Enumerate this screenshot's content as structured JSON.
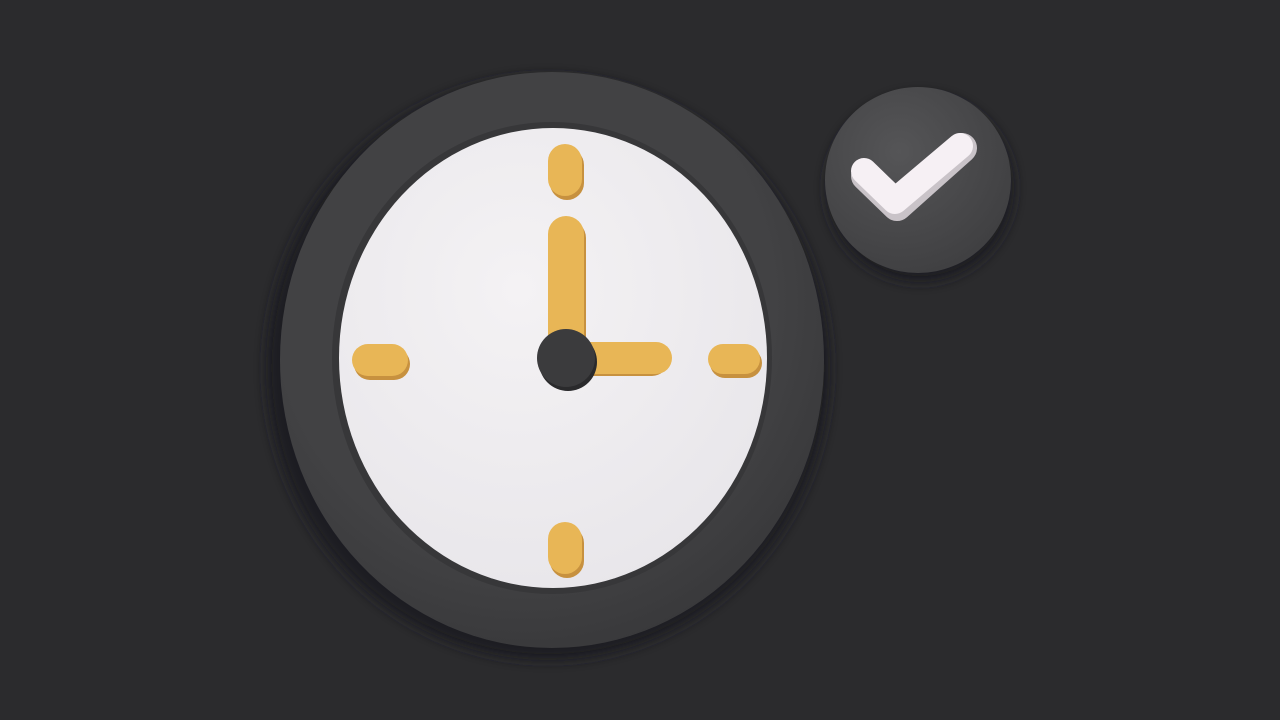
{
  "scene": {
    "background_color": "#2b2b2d",
    "clock": {
      "rim_color": "#424244",
      "rim_shadow_color": "#373739",
      "face_color": "#e8e6ea",
      "face_highlight_color": "#f4f2f4",
      "marker_color": "#e8b656",
      "marker_shadow_color": "#c7913f",
      "hub_color": "#3b3b3d",
      "shown_time": {
        "hour": 3,
        "minute": 0
      }
    },
    "check_badge": {
      "badge_color": "#555557",
      "badge_shadow_color": "#3f3f41",
      "check_color": "#f6f0f4",
      "icon": "checkmark-icon"
    }
  }
}
